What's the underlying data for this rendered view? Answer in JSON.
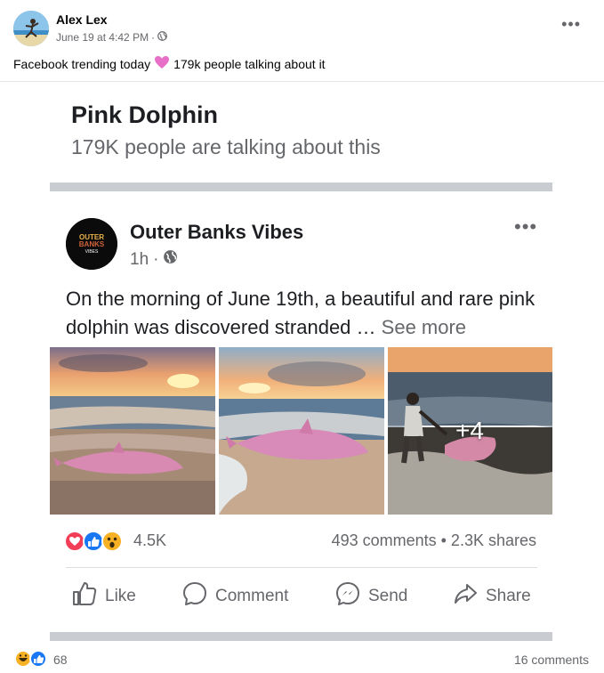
{
  "post": {
    "author": "Alex Lex",
    "timestamp": "June 19 at 4:42 PM",
    "separator": "·",
    "caption_before": "Facebook trending today",
    "caption_after": "179k people talking about it",
    "more_label": "•••"
  },
  "shared": {
    "trend_title": "Pink Dolphin",
    "trend_subtitle": "179K people are talking about this",
    "page_name": "Outer Banks Vibes",
    "page_time": "1h",
    "separator": "·",
    "logo_text_1": "OUTER",
    "logo_text_2": "BANKS",
    "logo_text_3": "VIBES",
    "body_text": "On the morning of June 19th, a beautiful and rare pink dolphin was discovered stranded … ",
    "see_more": "See more",
    "photo_overlay": "+4",
    "reaction_count": "4.5K",
    "comments_shares": "493 comments • 2.3K shares",
    "more_label": "•••",
    "actions": {
      "like": "Like",
      "comment": "Comment",
      "send": "Send",
      "share": "Share"
    }
  },
  "footer": {
    "reaction_count": "68",
    "comments": "16 comments"
  },
  "colors": {
    "fb_blue": "#1877f2",
    "love_red": "#f33e58",
    "haha_yellow": "#f7b125",
    "secondary_text": "#65676b",
    "heart_pink": "#e86fc8"
  }
}
